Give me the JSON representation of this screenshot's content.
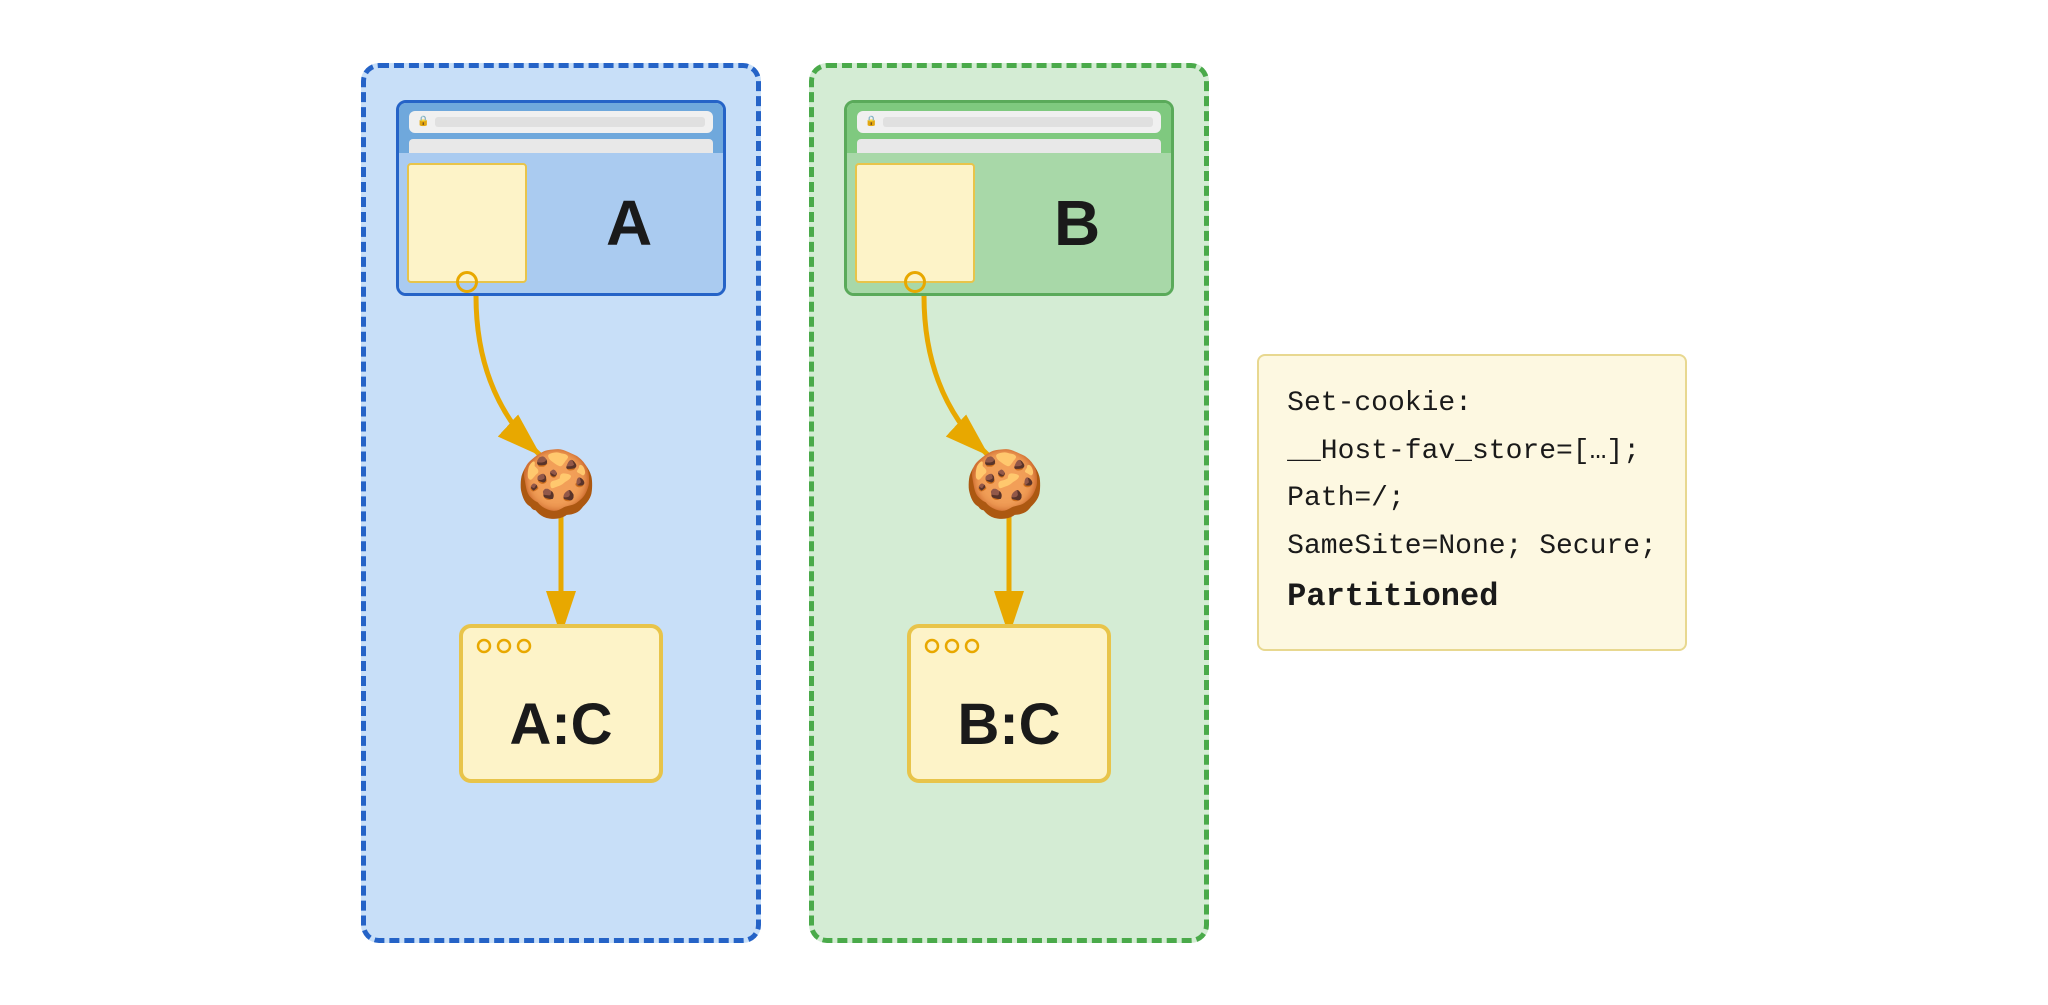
{
  "diagram": {
    "partition_a": {
      "label": "A",
      "storage_label": "A:C",
      "color": "blue"
    },
    "partition_b": {
      "label": "B",
      "storage_label": "B:C",
      "color": "green"
    },
    "code_block": {
      "lines": [
        "Set-cookie:",
        "__Host-fav_store=[…];",
        "Path=/;",
        "SameSite=None; Secure;",
        "Partitioned"
      ],
      "bold_line_index": 4
    }
  }
}
